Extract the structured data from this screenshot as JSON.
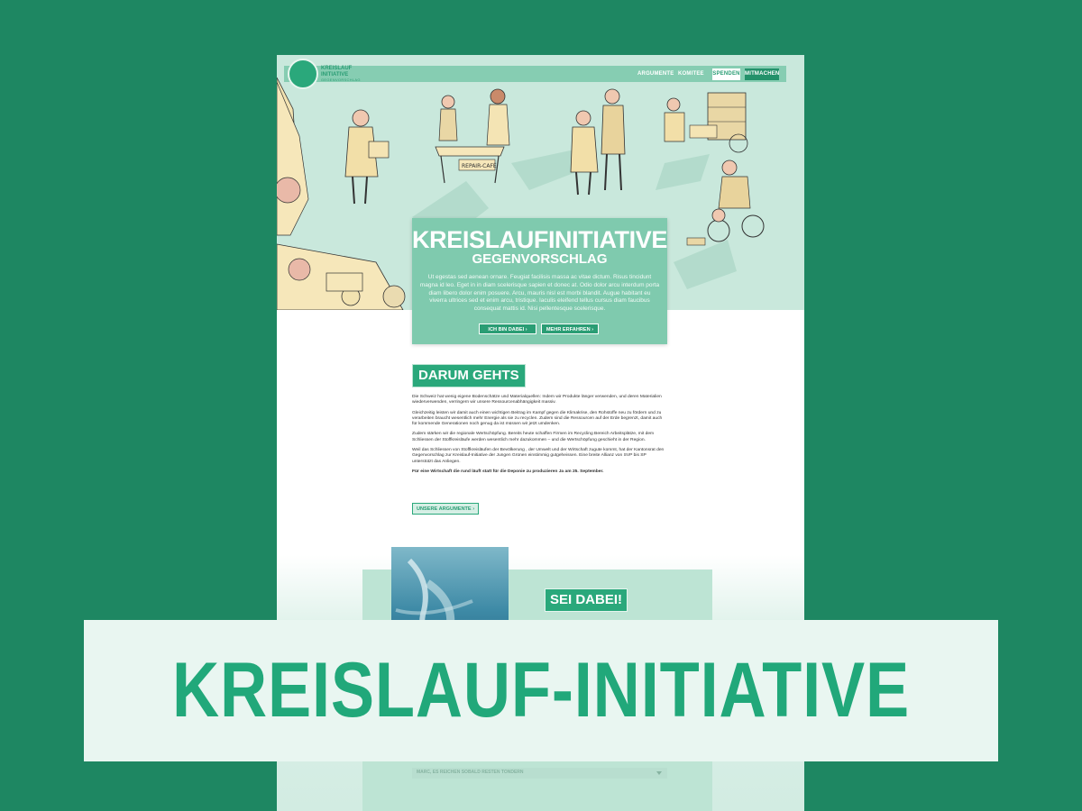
{
  "brand": {
    "logo_line1": "KREISLAUF",
    "logo_line2": "INITIATIVE",
    "logo_line3": "GEGENVORSCHLAG"
  },
  "nav": {
    "items": [
      {
        "label": "ARGUMENTE"
      },
      {
        "label": "KOMITEE"
      },
      {
        "label": "SPENDEN"
      },
      {
        "label": "MITMACHEN"
      }
    ]
  },
  "hero": {
    "title": "KREISLAUFINITIATIVE",
    "subtitle": "GEGENVORSCHLAG",
    "body": "Ut egestas sed aenean ornare. Feugiat facilisis massa ac vitae dictum. Risus tincidunt magna id leo. Eget in in diam scelerisque sapien et donec at. Odio dolor arcu interdum porta diam libero dolor enim posuere. Arcu, mauris nisl est morbi blandit. Augue habitant eu viverra ultrices sed et enim arcu, tristique. Iaculis eleifend tellus cursus diam faucibus consequat mattis id. Nisi pellentesque scelerisque.",
    "btn_dabei": "ICH BIN DABEI ›",
    "btn_mehr": "MEHR ERFAHREN ›",
    "sign_text": "REPAIR-CAFÉ"
  },
  "darum": {
    "heading": "DARUM GEHTS",
    "paragraphs": [
      "Die Schweiz hat wenig eigene Bodenschätze und Materialquellen: Indem wir Produkte länger verwenden, und deren Materialien wiederverwenden, verringern wir unsere Ressourcenabhängigkeit massiv.",
      "Gleichzeitig leisten wir damit auch einen wichtigen Beitrag im Kampf gegen die Klimakrise, den Rohstoffe neu zu fördern und zu verarbeiten braucht wesentlich mehr Energie als sie zu recyclen. Zudem sind die Ressourcen auf der Erde begrenzt, damit auch für kommende Generationen noch genug da ist müssen wir jetzt umdenken.",
      "Zudem stärken wir die regionale Wertschöpfung. Bereits heute schaffen Firmen im Recycling Bereich Arbeitsplätze, mit dem Schliessen der Stoffkreisläufe werden wesentlich mehr dazukommen – und die Wertschöpfung geschieht in der Region.",
      "Weil das Schliessen von Stoffkreisläufen der Bevölkerung , der Umwelt und der Wirtschaft zugute kommt, hat der Kantonsrat den Gegenvorschlag zur Kreislauf-Initiative der Jungen Grünen einstimmig gutgeheissen. Eine breite Allianz von SVP bis SP unterstützt das Anliegen."
    ],
    "strong": "Für eine Wirtschaft die rund läuft statt für die Deponie zu produzieren Ja am 25. September.",
    "btn_argumente": "UNSERE ARGUMENTE ›"
  },
  "sei_dabei": {
    "heading": "SEI DABEI!",
    "faded_row": "MARC, ES REICHEN SOBALD RESTEN TONDERN"
  },
  "banner": {
    "text": "KREISLAUF-INITIATIVE"
  },
  "colors": {
    "background": "#1e8762",
    "accent": "#2aa87b",
    "hero_card": "#7fcaae",
    "banner_bg": "#e9f6f1",
    "banner_text": "#21a87a"
  }
}
